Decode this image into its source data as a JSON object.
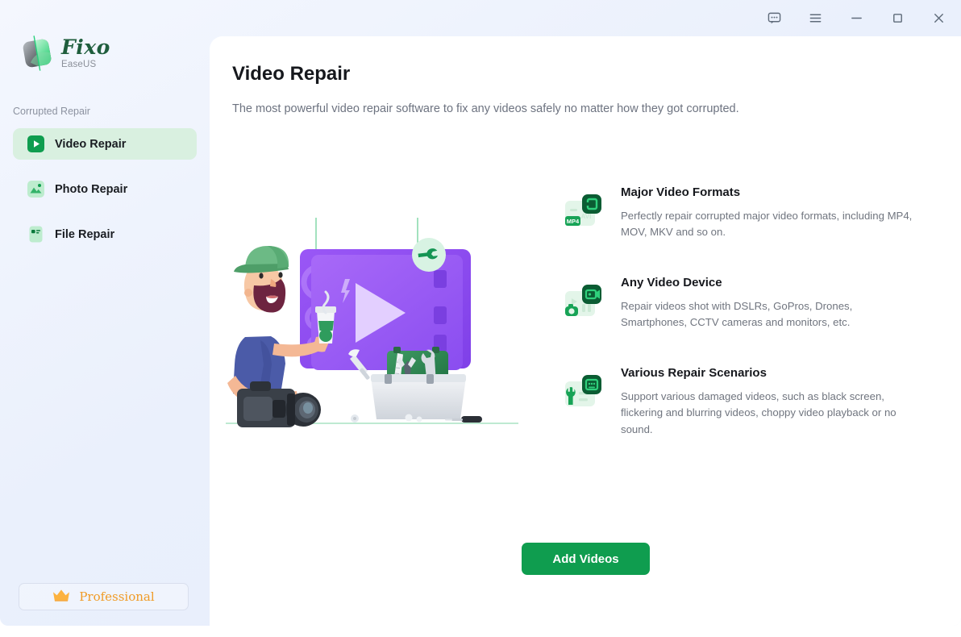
{
  "window": {
    "controls": [
      {
        "name": "feedback-icon",
        "label": "Feedback"
      },
      {
        "name": "menu-icon",
        "label": "Menu"
      },
      {
        "name": "minimize-icon",
        "label": "Minimize"
      },
      {
        "name": "maximize-icon",
        "label": "Maximize"
      },
      {
        "name": "close-icon",
        "label": "Close"
      }
    ]
  },
  "sidebar": {
    "brand": {
      "name": "Fixo",
      "sub": "EaseUS",
      "logo_icon": "fixo-logo-icon"
    },
    "section_label": "Corrupted Repair",
    "items": [
      {
        "label": "Video Repair",
        "icon": "video-repair-icon",
        "active": true
      },
      {
        "label": "Photo Repair",
        "icon": "photo-repair-icon",
        "active": false
      },
      {
        "label": "File Repair",
        "icon": "file-repair-icon",
        "active": false
      }
    ],
    "professional": {
      "label": "Professional",
      "icon": "crown-icon"
    }
  },
  "main": {
    "title": "Video Repair",
    "subtitle": "The most powerful video repair software to fix any videos safely no matter how they got corrupted.",
    "illustration_name": "videographer-video-repair-illustration",
    "features": [
      {
        "icon": "video-formats-icon",
        "title": "Major Video Formats",
        "desc": "Perfectly repair corrupted major video formats, including MP4, MOV, MKV and so on."
      },
      {
        "icon": "video-device-icon",
        "title": "Any Video Device",
        "desc": "Repair videos shot with DSLRs, GoPros, Drones, Smartphones, CCTV cameras and monitors, etc."
      },
      {
        "icon": "repair-scenarios-icon",
        "title": "Various Repair Scenarios",
        "desc": "Support various damaged videos, such as black screen, flickering and blurring videos, choppy video playback or no sound."
      }
    ],
    "cta": {
      "label": "Add Videos"
    }
  },
  "colors": {
    "brand_green": "#0f9d4f",
    "dark_green": "#0b5c33",
    "accent_purple": "#9b5cf6",
    "sidebar_bg": "#eef2fd",
    "active_item_bg": "#d9f0e0",
    "pro_orange": "#f09a25",
    "title_text": "#16181d",
    "muted_text": "#70757f"
  }
}
